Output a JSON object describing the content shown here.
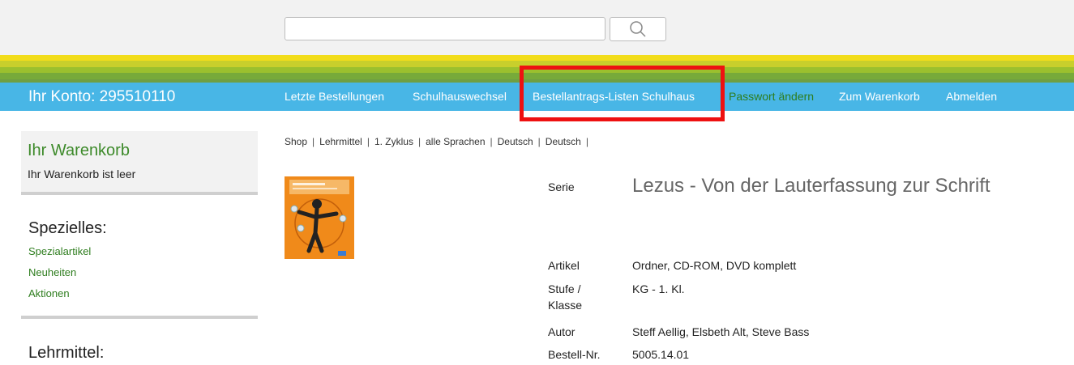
{
  "search": {
    "placeholder": ""
  },
  "nav": {
    "account": "Ihr Konto: 295510110",
    "items": [
      {
        "label": "Letzte Bestellungen"
      },
      {
        "label": "Schulhauswechsel"
      },
      {
        "label": "Bestellantrags-Listen Schulhaus"
      },
      {
        "label": "Passwort ändern"
      },
      {
        "label": "Zum Warenkorb"
      },
      {
        "label": "Abmelden"
      }
    ]
  },
  "sidebar": {
    "cart_title": "Ihr Warenkorb",
    "cart_status": "Ihr Warenkorb ist leer",
    "special_heading": "Spezielles:",
    "special_links": [
      "Spezialartikel",
      "Neuheiten",
      "Aktionen"
    ],
    "teaching_heading": "Lehrmittel:"
  },
  "breadcrumb": [
    "Shop",
    "Lehrmittel",
    "1. Zyklus",
    "alle Sprachen",
    "Deutsch",
    "Deutsch"
  ],
  "product": {
    "series_label": "Serie",
    "title": "Lezus - Von der Lauterfassung zur Schrift",
    "rows": [
      {
        "label": "Artikel",
        "value": "Ordner, CD-ROM, DVD komplett"
      },
      {
        "label": "Stufe / Klasse",
        "value": "KG - 1. Kl."
      },
      {
        "label": "Autor",
        "value": "Steff Aellig, Elsbeth Alt, Steve Bass"
      },
      {
        "label": "Bestell-Nr.",
        "value": "5005.14.01"
      }
    ]
  },
  "colors": {
    "nav_bg": "#48b6e6",
    "accent_green": "#3d8a2a",
    "highlight": "#ee1111"
  }
}
